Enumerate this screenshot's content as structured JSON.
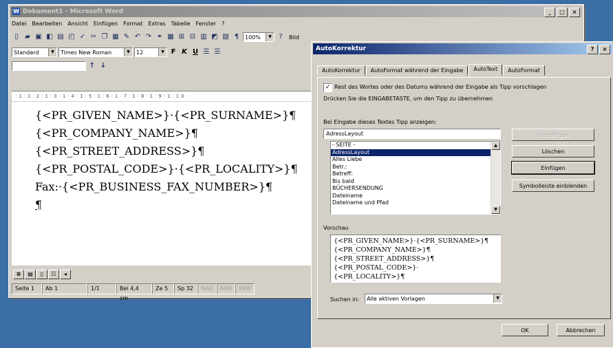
{
  "word": {
    "title": "Dokument1 - Microsoft Word",
    "menu": [
      "Datei",
      "Bearbeiten",
      "Ansicht",
      "Einfügen",
      "Format",
      "Extras",
      "Tabelle",
      "Fenster",
      "?"
    ],
    "style_value": "Standard",
    "font_value": "Times New Roman",
    "size_value": "12",
    "bold": "F",
    "italic": "K",
    "underline": "U",
    "zoom_value": "100%",
    "read_label": "Bild",
    "doc_lines": [
      "{<PR_GIVEN_NAME>}·{<PR_SURNAME>}¶",
      "{<PR_COMPANY_NAME>}¶",
      "{<PR_STREET_ADDRESS>}¶",
      "{<PR_POSTAL_CODE>}·{<PR_LOCALITY>}¶",
      "Fax:·{<PR_BUSINESS_FAX_NUMBER>}¶",
      "¶"
    ],
    "status": {
      "page": "Seite 1",
      "section": "Ab 1",
      "pages": "1/1",
      "position": "Bei 4,4 cm",
      "line": "Ze 5",
      "column": "Sp 32",
      "mak": "MAK",
      "aend": "ÄND",
      "erw": "ERW"
    }
  },
  "dialog": {
    "title": "AutoKorrektur",
    "help": "?",
    "close": "×",
    "tabs": [
      "AutoKorrektur",
      "AutoFormat während der Eingabe",
      "AutoText",
      "AutoFormat"
    ],
    "active_tab": 2,
    "checkbox_label": "Rest des Wortes oder des Datums während der Eingabe als Tipp vorschlagen",
    "checkbox_checked": true,
    "hint_text": "Drücken Sie die EINGABETASTE, um den Tipp zu übernehmen",
    "entry_label": "Bei Eingabe dieses Textes Tipp anzeigen:",
    "entry_value": "AdressLayout",
    "list_items": [
      "- SEITE -",
      "AdressLayout",
      "Alles Liebe",
      "Betr.:",
      "Betreff:",
      "Bis bald",
      "BÜCHERSENDUNG",
      "Dateiname",
      "Dateiname und Pfad"
    ],
    "selected_index": 1,
    "buttons": {
      "add": "Hinzufügen",
      "delete": "Löschen",
      "insert": "Einfügen",
      "toolbar": "Symbolleiste einblenden"
    },
    "preview_label": "Vorschau",
    "preview_lines": [
      "{<PR_GIVEN_NAME>}·{<PR_SURNAME>}¶",
      "{<PR_COMPANY_NAME>}¶",
      "{<PR_STREET_ADDRESS>}¶",
      "{<PR_POSTAL_CODE>}·",
      "{<PR_LOCALITY>}¶"
    ],
    "search_label": "Suchen in:",
    "search_value": "Alle aktiven Vorlagen",
    "ok": "OK",
    "cancel": "Abbrechen"
  },
  "colors": {
    "desktop": "#3a6ea5",
    "title_active": "#0a246a",
    "selection": "#0a246a"
  }
}
